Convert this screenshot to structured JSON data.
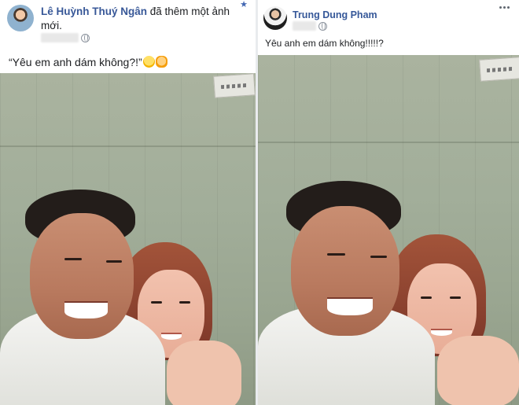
{
  "posts": [
    {
      "author": "Lê Huỳnh Thuý Ngân",
      "action": " đã thêm một ảnh mới.",
      "privacy_icon": "globe-icon",
      "caption": "“Yêu em anh dám không?!”",
      "emojis": [
        "rofl-emoji",
        "raising-hands-emoji"
      ],
      "corner_icon": "star-icon",
      "corner_glyph": "★"
    },
    {
      "author": "Trung Dung Pham",
      "privacy_icon": "globe-icon",
      "caption": "Yêu anh em dám không!!!!!?",
      "corner_icon": "more-options-icon"
    }
  ],
  "colors": {
    "author_link": "#385898",
    "text": "#1c1e21",
    "secondary_icon": "#8d949e",
    "divider": "#e9ebee"
  }
}
